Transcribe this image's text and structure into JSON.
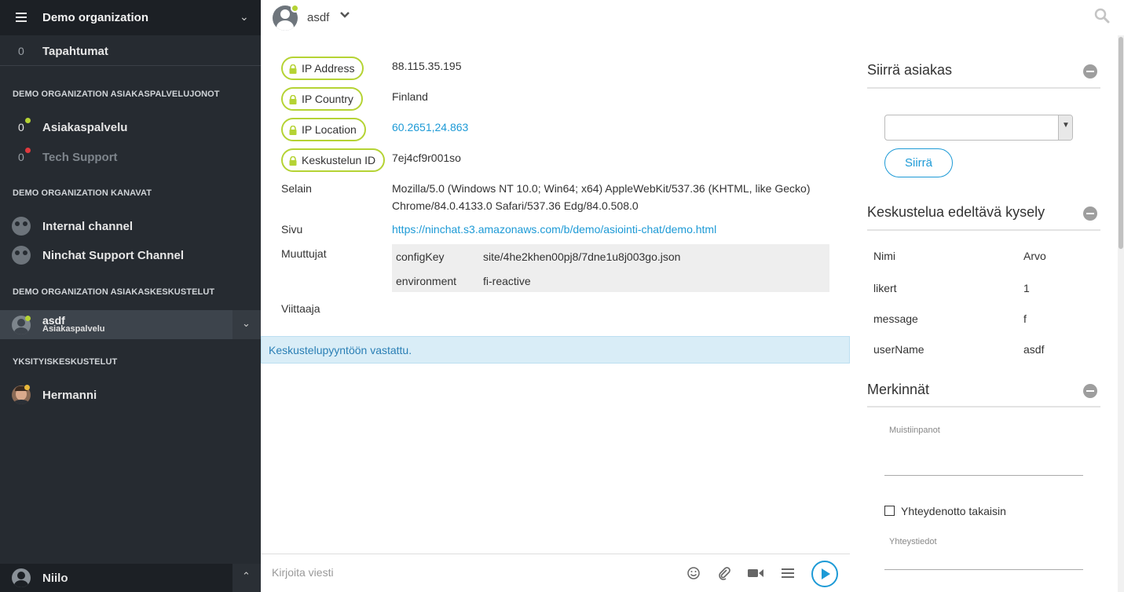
{
  "sidebar": {
    "org_title": "Demo organization",
    "events": {
      "count": "0",
      "label": "Tapahtumat"
    },
    "section_queues": "DEMO ORGANIZATION ASIAKASPALVELUJONOT",
    "queues": [
      {
        "count": "0",
        "label": "Asiakaspalvelu",
        "status": "online"
      },
      {
        "count": "0",
        "label": "Tech Support",
        "status": "offline"
      }
    ],
    "section_channels": "DEMO ORGANIZATION KANAVAT",
    "channels": [
      {
        "label": "Internal channel"
      },
      {
        "label": "Ninchat Support Channel"
      }
    ],
    "section_conversations": "DEMO ORGANIZATION ASIAKASKESKUSTELUT",
    "active_conversation": {
      "name": "asdf",
      "queue": "Asiakaspalvelu"
    },
    "section_private": "YKSITYISKESKUSTELUT",
    "private": [
      {
        "label": "Hermanni"
      }
    ],
    "current_user": "Niilo"
  },
  "topbar": {
    "name": "asdf"
  },
  "info": {
    "ip_address": {
      "label": "IP Address",
      "value": "88.115.35.195"
    },
    "ip_country": {
      "label": "IP Country",
      "value": "Finland"
    },
    "ip_location": {
      "label": "IP Location",
      "value": "60.2651,24.863"
    },
    "conversation_id": {
      "label": "Keskustelun ID",
      "value": "7ej4cf9r001so"
    },
    "browser": {
      "label": "Selain",
      "line1": "Mozilla/5.0 (Windows NT 10.0; Win64; x64) AppleWebKit/537.36 (KHTML, like Gecko)",
      "line2": "Chrome/84.0.4133.0 Safari/537.36 Edg/84.0.508.0"
    },
    "page": {
      "label": "Sivu",
      "value": "https://ninchat.s3.amazonaws.com/b/demo/asiointi-chat/demo.html"
    },
    "variables": {
      "label": "Muuttujat",
      "rows": [
        {
          "key": "configKey",
          "value": "site/4he2khen00pj8/7dne1u8j003go.json"
        },
        {
          "key": "environment",
          "value": "fi-reactive"
        }
      ]
    },
    "referrer": {
      "label": "Viittaaja"
    }
  },
  "notice": "Keskustelupyyntöön vastattu.",
  "composer": {
    "placeholder": "Kirjoita viesti"
  },
  "right_panel": {
    "transfer": {
      "title": "Siirrä asiakas",
      "select_value": "",
      "button": "Siirrä"
    },
    "survey": {
      "title": "Keskustelua edeltävä kysely",
      "header": {
        "name": "Nimi",
        "value": "Arvo"
      },
      "rows": [
        {
          "name": "likert",
          "value": "1"
        },
        {
          "name": "message",
          "value": "f"
        },
        {
          "name": "userName",
          "value": "asdf"
        }
      ]
    },
    "notes": {
      "title": "Merkinnät",
      "notes_label": "Muistiinpanot",
      "callback_label": "Yhteydenotto takaisin",
      "contact_label": "Yhteystiedot"
    }
  },
  "colors": {
    "accent": "#1d9ad6",
    "online": "#b5d334",
    "offline": "#e0393e",
    "sidebar": "#262b31"
  }
}
